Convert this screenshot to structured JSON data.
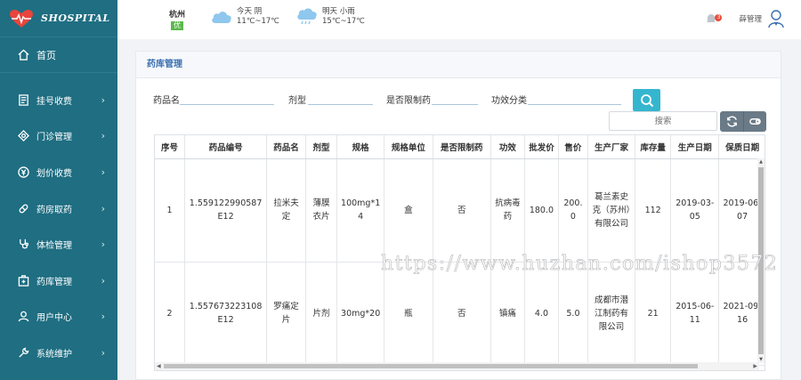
{
  "brand": {
    "name": "SHOSPITAL"
  },
  "header": {
    "city": "杭州",
    "aqi": "优",
    "today": {
      "label": "今天 阴",
      "temp": "11℃~17℃"
    },
    "tomorrow": {
      "label": "明天 小雨",
      "temp": "15℃~17℃"
    },
    "notifications": "3",
    "user": "薛管理"
  },
  "sidebar": {
    "home": "首页",
    "items": [
      {
        "label": "挂号收费"
      },
      {
        "label": "门诊管理"
      },
      {
        "label": "划价收费"
      },
      {
        "label": "药房取药"
      },
      {
        "label": "体检管理"
      },
      {
        "label": "药库管理"
      },
      {
        "label": "用户中心"
      },
      {
        "label": "系统维护"
      }
    ]
  },
  "panel": {
    "title": "药库管理"
  },
  "filters": {
    "drug_name": "药品名",
    "dosage_form": "剂型",
    "restricted": "是否限制药",
    "efficacy": "功效分类"
  },
  "toolbar": {
    "search_placeholder": "搜索"
  },
  "table": {
    "headers": [
      "序号",
      "药品编号",
      "药品名",
      "剂型",
      "规格",
      "规格单位",
      "是否限制药",
      "功效",
      "批发价",
      "售价",
      "生产厂家",
      "库存量",
      "生产日期",
      "保质日期"
    ],
    "rows": [
      [
        "1",
        "1.559122990587E12",
        "拉米夫定",
        "薄膜衣片",
        "100mg*14",
        "盒",
        "否",
        "抗病毒药",
        "180.0",
        "200.0",
        "葛兰素史克（苏州）有限公司",
        "112",
        "2019-03-05",
        "2019-06-07"
      ],
      [
        "2",
        "1.557673223108E12",
        "罗痛定片",
        "片剂",
        "30mg*20",
        "瓶",
        "否",
        "镇痛",
        "4.0",
        "5.0",
        "成都市潜江制药有限公司",
        "21",
        "2015-06-11",
        "2021-09-16"
      ]
    ]
  },
  "watermark": "https://www.huzhan.com/ishop3572",
  "colors": {
    "sidebar": "#1f6e82",
    "accent": "#35b6cf",
    "title": "#3a6fb0"
  }
}
